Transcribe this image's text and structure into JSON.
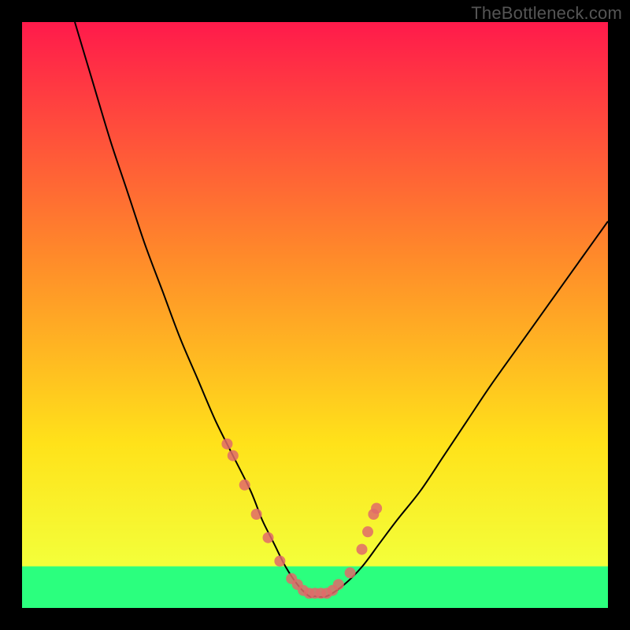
{
  "watermark": "TheBottleneck.com",
  "chart_data": {
    "type": "line",
    "title": "",
    "xlabel": "",
    "ylabel": "",
    "xlim": [
      0,
      100
    ],
    "ylim": [
      0,
      100
    ],
    "grid": false,
    "legend": false,
    "gradient": {
      "top_color": "#ff1a4b",
      "mid_color_1": "#ff8a2a",
      "mid_color_2": "#ffe21a",
      "bottom_color": "#2bff7e",
      "green_band_start_pct": 93
    },
    "series": [
      {
        "name": "bottleneck-curve",
        "color": "#000000",
        "stroke_width": 2,
        "x": [
          9,
          12,
          15,
          18,
          21,
          24,
          27,
          30,
          33,
          36,
          39,
          41,
          43,
          45,
          47,
          49,
          50,
          52,
          55,
          58,
          61,
          64,
          68,
          72,
          76,
          80,
          85,
          90,
          95,
          100
        ],
        "y_pct": [
          100,
          90,
          80,
          71,
          62,
          54,
          46,
          39,
          32,
          26,
          20,
          15,
          11,
          7,
          4,
          2,
          2,
          2,
          4,
          7,
          11,
          15,
          20,
          26,
          32,
          38,
          45,
          52,
          59,
          66
        ],
        "description": "Approximate V-shaped bottleneck curve. y_pct is percentage of plot height from bottom; minimum (~2%) around x≈49–52; left arm reaches 100% near x≈9; right arm reaches ~66% at x=100."
      },
      {
        "name": "highlight-dots",
        "color": "#e16a6a",
        "type": "scatter",
        "radius": 7,
        "x": [
          35,
          36,
          38,
          40,
          42,
          44,
          46,
          47,
          48,
          49,
          50,
          51,
          52,
          53,
          54,
          56,
          58,
          59,
          60,
          60.5
        ],
        "y_pct": [
          28,
          26,
          21,
          16,
          12,
          8,
          5,
          4,
          3,
          2.5,
          2.5,
          2.5,
          2.5,
          3,
          4,
          6,
          10,
          13,
          16,
          17
        ],
        "description": "Cluster of salmon dots near and along the valley of the curve, slightly denser on the flat bottom and lower flanks."
      }
    ]
  }
}
